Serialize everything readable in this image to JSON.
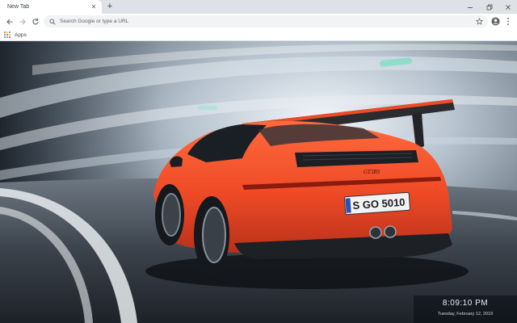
{
  "browser": {
    "tab": {
      "title": "New Tab"
    },
    "omnibox": {
      "placeholder": "Search Google or type a URL",
      "value": ""
    },
    "bookmarks": {
      "apps_label": "Apps"
    }
  },
  "icons": {
    "tab_close": "close-icon",
    "new_tab": "plus-icon",
    "minimize": "minimize-icon",
    "maximize": "restore-icon",
    "close_window": "close-icon",
    "back": "arrow-left-icon",
    "forward": "arrow-right-icon",
    "reload": "reload-icon",
    "search": "search-icon",
    "bookmark": "star-icon",
    "profile": "account-icon",
    "menu": "kebab-menu-icon",
    "apps": "apps-grid-icon"
  },
  "colors": {
    "tabstrip": "#dee1e6",
    "toolbar": "#ffffff",
    "omnibox": "#f1f3f4",
    "car": "#ef4a26",
    "apps_dots": [
      "#ea4335",
      "#fbbc05",
      "#34a853",
      "#4285f4",
      "#ea4335",
      "#fbbc05",
      "#34a853",
      "#4285f4",
      "#ea4335"
    ]
  },
  "wallpaper": {
    "subject": "red sports car in a tunnel",
    "plate_text": "S GO 5010",
    "badge_text": "GT3RS",
    "clock": {
      "time": "8:09:10 PM",
      "date": "Tuesday, February 12, 2019"
    }
  }
}
